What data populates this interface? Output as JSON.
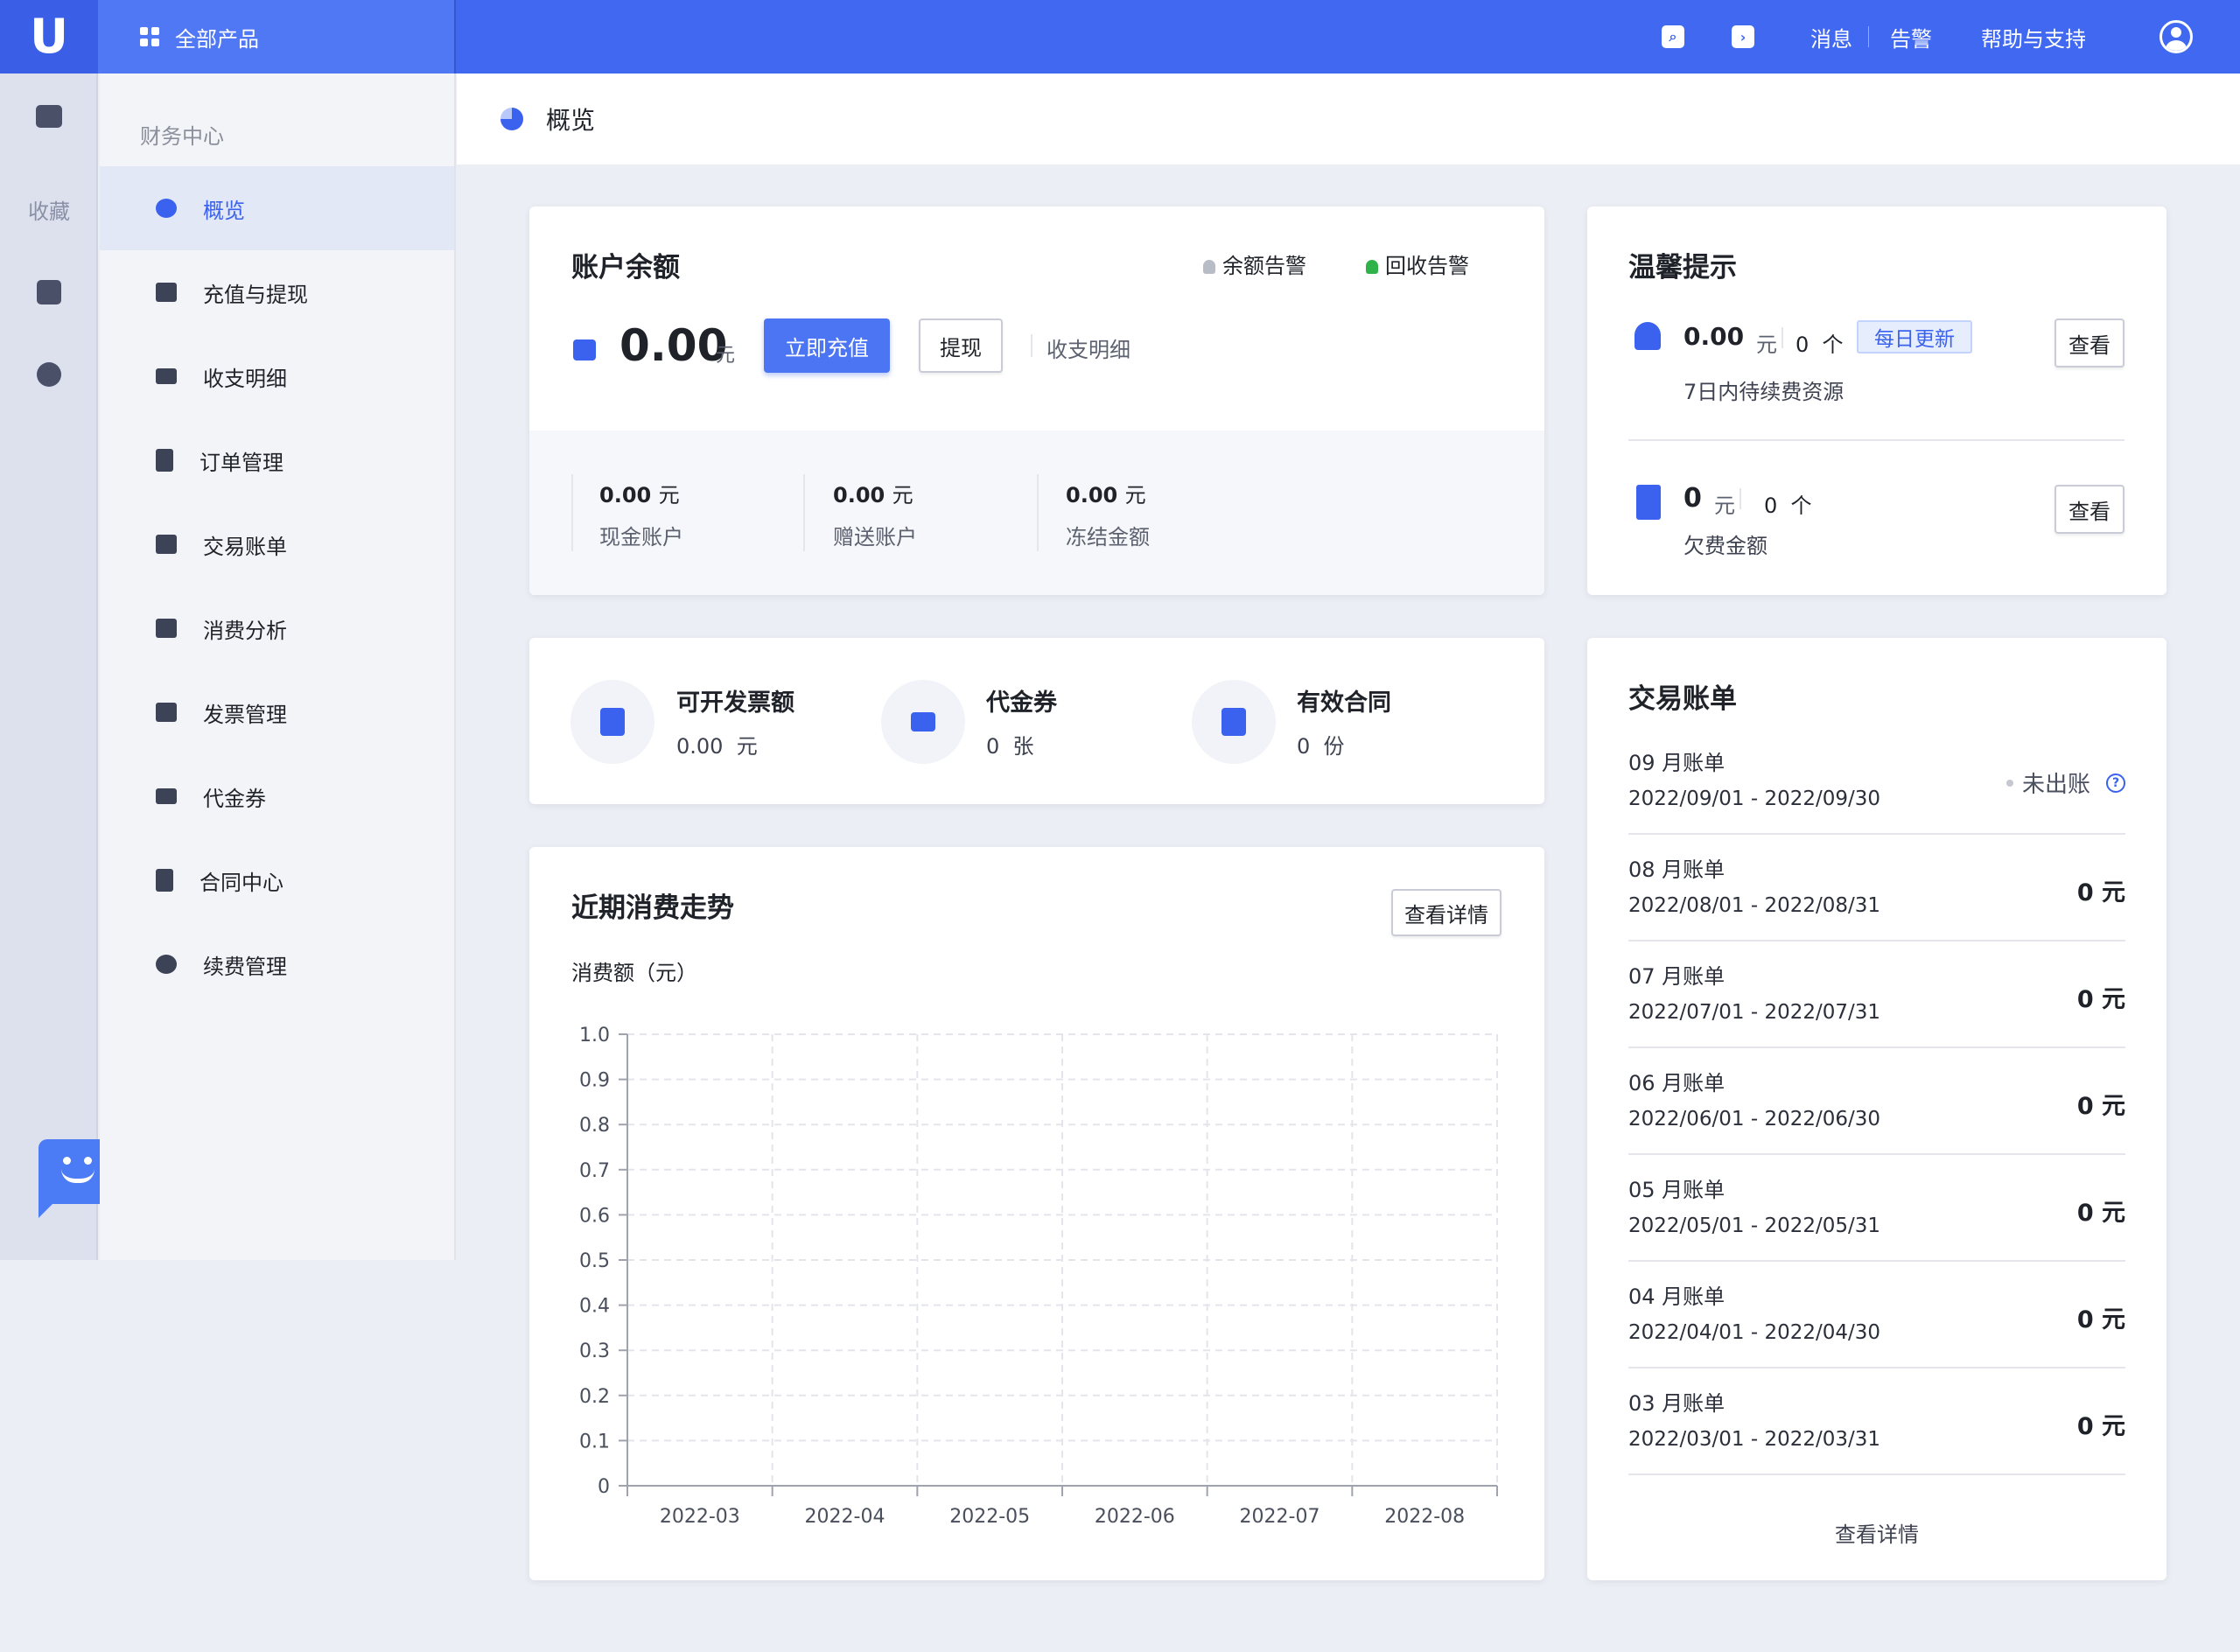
{
  "topbar": {
    "logo": "U",
    "all_products": "全部产品",
    "messages": "消息",
    "alerts": "告警",
    "help": "帮助与支持"
  },
  "rail": {
    "favorites": "收藏"
  },
  "menu": {
    "group": "财务中心",
    "items": [
      {
        "label": "概览"
      },
      {
        "label": "充值与提现"
      },
      {
        "label": "收支明细"
      },
      {
        "label": "订单管理"
      },
      {
        "label": "交易账单"
      },
      {
        "label": "消费分析"
      },
      {
        "label": "发票管理"
      },
      {
        "label": "代金券"
      },
      {
        "label": "合同中心"
      },
      {
        "label": "续费管理"
      }
    ]
  },
  "page_title": "概览",
  "balance": {
    "title": "账户余额",
    "alert_balance": "余额告警",
    "alert_recycle": "回收告警",
    "amount": "0.00",
    "unit": "元",
    "recharge": "立即充值",
    "withdraw": "提现",
    "details": "收支明细",
    "sub": [
      {
        "value": "0.00",
        "unit": "元",
        "label": "现金账户"
      },
      {
        "value": "0.00",
        "unit": "元",
        "label": "赠送账户"
      },
      {
        "value": "0.00",
        "unit": "元",
        "label": "冻结金额"
      }
    ]
  },
  "tips": {
    "title": "温馨提示",
    "renew": {
      "amount": "0.00",
      "unit": "元",
      "count": "0",
      "count_unit": "个",
      "tag": "每日更新",
      "desc": "7日内待续费资源",
      "button": "查看"
    },
    "arrears": {
      "amount": "0",
      "unit": "元",
      "count": "0",
      "count_unit": "个",
      "desc": "欠费金额",
      "button": "查看"
    }
  },
  "stats": [
    {
      "title": "可开发票额",
      "value": "0.00",
      "unit": "元"
    },
    {
      "title": "代金券",
      "value": "0",
      "unit": "张"
    },
    {
      "title": "有效合同",
      "value": "0",
      "unit": "份"
    }
  ],
  "trend": {
    "title": "近期消费走势",
    "button": "查看详情"
  },
  "chart_data": {
    "type": "line",
    "ylabel": "消费额（元）",
    "categories": [
      "2022-03",
      "2022-04",
      "2022-05",
      "2022-06",
      "2022-07",
      "2022-08"
    ],
    "series": [
      {
        "values": [
          0,
          0,
          0,
          0,
          0,
          0
        ]
      }
    ],
    "ylim": [
      0,
      1.0
    ],
    "yticks": [
      "0",
      "0.1",
      "0.2",
      "0.3",
      "0.4",
      "0.5",
      "0.6",
      "0.7",
      "0.8",
      "0.9",
      "1.0"
    ],
    "grid": true
  },
  "bills": {
    "title": "交易账单",
    "more": "查看详情",
    "rows": [
      {
        "name": "09 月账单",
        "range": "2022/09/01 - 2022/09/30",
        "status": "未出账"
      },
      {
        "name": "08 月账单",
        "range": "2022/08/01 - 2022/08/31",
        "amount": "0 元"
      },
      {
        "name": "07 月账单",
        "range": "2022/07/01 - 2022/07/31",
        "amount": "0 元"
      },
      {
        "name": "06 月账单",
        "range": "2022/06/01 - 2022/06/30",
        "amount": "0 元"
      },
      {
        "name": "05 月账单",
        "range": "2022/05/01 - 2022/05/31",
        "amount": "0 元"
      },
      {
        "name": "04 月账单",
        "range": "2022/04/01 - 2022/04/30",
        "amount": "0 元"
      },
      {
        "name": "03 月账单",
        "range": "2022/03/01 - 2022/03/31",
        "amount": "0 元"
      }
    ]
  },
  "colors": {
    "primary": "#4168f0",
    "accent": "#3a62ee",
    "alert_green": "#2fb24a"
  }
}
